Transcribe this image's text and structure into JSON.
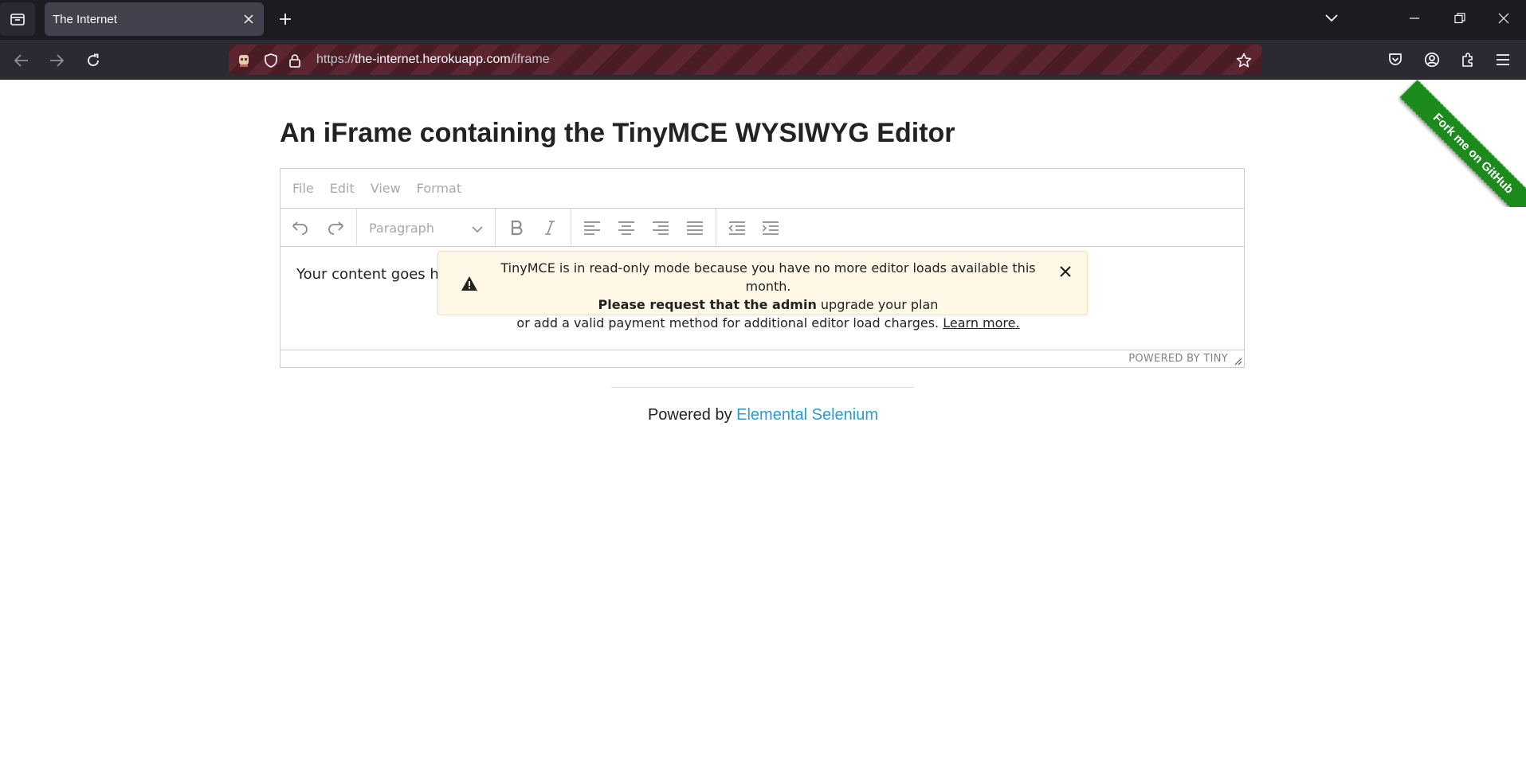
{
  "browser": {
    "tab_title": "The Internet",
    "url_scheme": "https://",
    "url_host": "the-internet.herokuapp.com",
    "url_path": "/iframe"
  },
  "page": {
    "title": "An iFrame containing the TinyMCE WYSIWYG Editor"
  },
  "editor": {
    "menu": [
      "File",
      "Edit",
      "View",
      "Format"
    ],
    "block_format": "Paragraph",
    "content_text": "Your content goes h",
    "powered_by": "POWERED BY TINY",
    "notice": {
      "line1": "TinyMCE is in read-only mode because you have no more editor loads available this month.",
      "line2_bold": "Please request that the admin",
      "line2_rest": " upgrade your plan",
      "line3": "or add a valid payment method for additional editor load charges. ",
      "link": "Learn more."
    }
  },
  "footer": {
    "prefix": "Powered by ",
    "link": "Elemental Selenium"
  },
  "ribbon": {
    "text": "Fork me on GitHub",
    "color": "#1c8a1c"
  },
  "colors": {
    "link": "#2a9bd4",
    "chrome_bg": "#1c1b22",
    "notice_bg": "#fff8e6"
  }
}
